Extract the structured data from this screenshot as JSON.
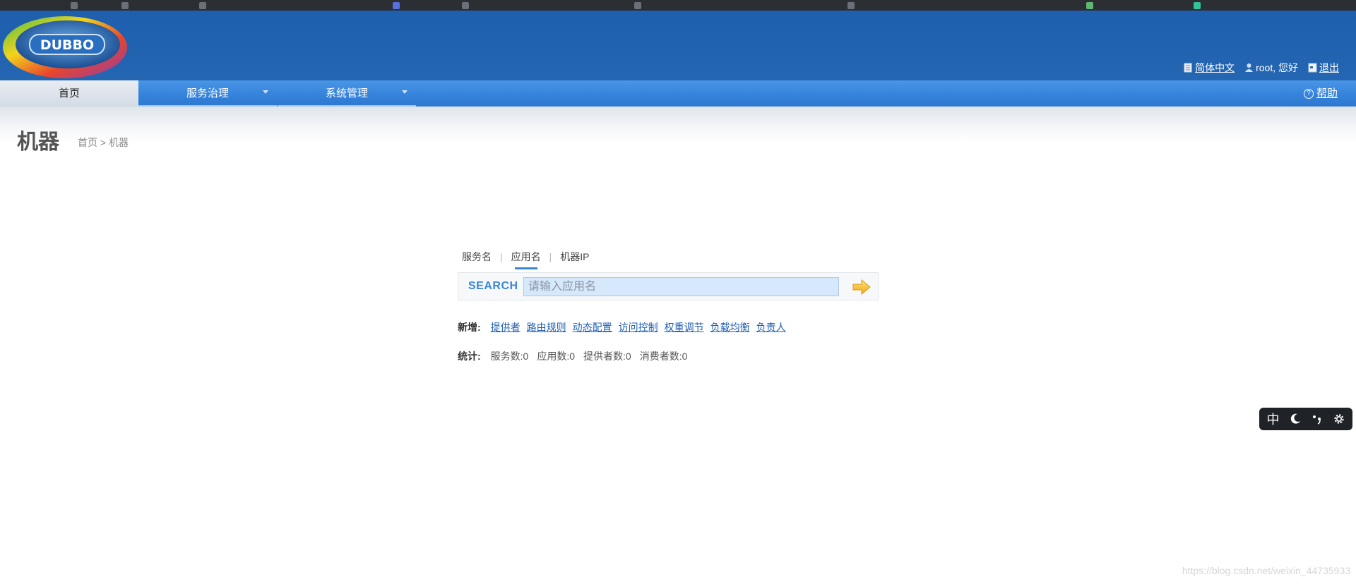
{
  "header": {
    "logo_text": "DUBBO",
    "language_label": "简体中文",
    "user_greeting": "root, 您好",
    "logout_label": "退出"
  },
  "nav": {
    "items": [
      {
        "label": "首页",
        "active": true
      },
      {
        "label": "服务治理",
        "dropdown": true
      },
      {
        "label": "系统管理",
        "dropdown": true
      }
    ],
    "help_label": "帮助"
  },
  "page": {
    "title": "机器",
    "breadcrumb": "首页 > 机器"
  },
  "search": {
    "tabs": [
      {
        "label": "服务名"
      },
      {
        "label": "应用名",
        "active": true
      },
      {
        "label": "机器IP"
      }
    ],
    "label": "SEARCH",
    "placeholder": "请输入应用名"
  },
  "add": {
    "label": "新增:",
    "links": [
      "提供者",
      "路由规则",
      "动态配置",
      "访问控制",
      "权重调节",
      "负载均衡",
      "负责人"
    ]
  },
  "stats": {
    "label": "统计:",
    "items": [
      "服务数:0",
      "应用数:0",
      "提供者数:0",
      "消费者数:0"
    ]
  },
  "ime_toolbar": {
    "mode_label": "中"
  },
  "watermark": "https://blog.csdn.net/weixin_44735933",
  "colors": {
    "header_bg": "#1e5fae",
    "nav_bg": "#3583dc",
    "accent": "#3a87d9",
    "link": "#1f5fb3"
  }
}
